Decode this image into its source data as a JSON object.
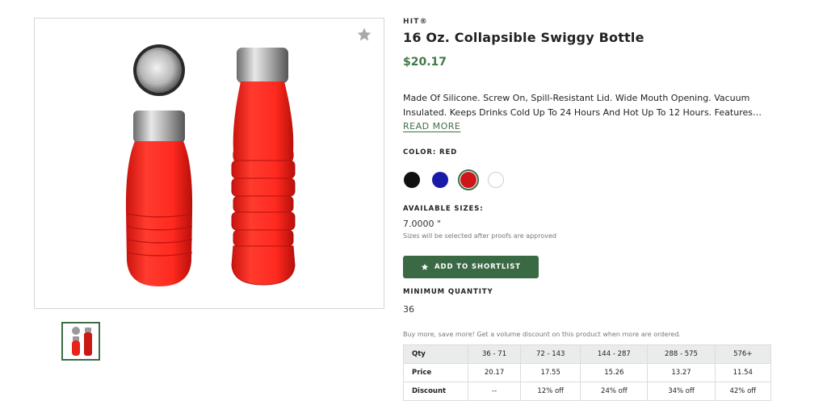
{
  "gallery": {
    "favorite_icon": "star-icon",
    "thumbnail_count": 1
  },
  "product": {
    "brand": "HIT®",
    "title": "16 Oz. Collapsible Swiggy Bottle",
    "price": "$20.17",
    "description": "Made Of Silicone. Screw On, Spill-Resistant Lid. Wide Mouth Opening. Vacuum Insulated. Keeps Drinks Cold Up To 24 Hours And Hot Up To 12 Hours. Features…",
    "read_more": "READ MORE"
  },
  "color": {
    "label": "COLOR: RED",
    "swatches": [
      {
        "name": "black",
        "hex": "#111111",
        "selected": false
      },
      {
        "name": "blue",
        "hex": "#1a1aa8",
        "selected": false
      },
      {
        "name": "red",
        "hex": "#d0141c",
        "selected": true
      },
      {
        "name": "white",
        "hex": "#ffffff",
        "selected": false
      }
    ]
  },
  "sizes": {
    "label": "AVAILABLE SIZES:",
    "value": "7.0000 \"",
    "note": "Sizes will be selected after proofs are approved"
  },
  "shortlist": {
    "label": "ADD TO SHORTLIST",
    "icon": "star-icon"
  },
  "minimum": {
    "label": "MINIMUM QUANTITY",
    "value": "36"
  },
  "volume": {
    "note": "Buy more, save more! Get a volume discount on this product when more are ordered."
  },
  "pricing_table": {
    "rows": [
      {
        "head": "Qty",
        "cells": [
          "36 - 71",
          "72 - 143",
          "144 - 287",
          "288 - 575",
          "576+"
        ]
      },
      {
        "head": "Price",
        "cells": [
          "20.17",
          "17.55",
          "15.26",
          "13.27",
          "11.54"
        ]
      },
      {
        "head": "Discount",
        "cells": [
          "--",
          "12% off",
          "24% off",
          "34% off",
          "42% off"
        ]
      }
    ]
  },
  "colors": {
    "accent": "#3a6a44",
    "price": "#3f7a47",
    "product_red": "#ff2a1f"
  }
}
